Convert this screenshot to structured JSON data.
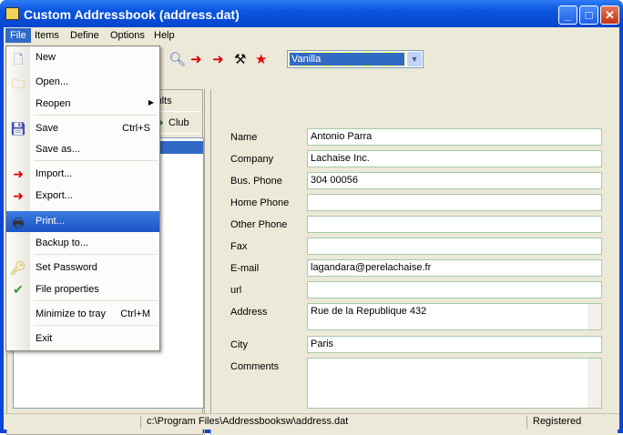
{
  "window": {
    "title": "Custom Addressbook (address.dat)"
  },
  "menubar": [
    "File",
    "Items",
    "Define",
    "Options",
    "Help"
  ],
  "toolbar": {
    "combo_value": "Vanilla"
  },
  "left": {
    "tabs": [
      "sults",
      "Club"
    ]
  },
  "fields": [
    {
      "label": "Name",
      "value": "Antonio Parra"
    },
    {
      "label": "Company",
      "value": "Lachaise Inc."
    },
    {
      "label": "Bus. Phone",
      "value": "304 00056"
    },
    {
      "label": "Home Phone",
      "value": ""
    },
    {
      "label": "Other Phone",
      "value": ""
    },
    {
      "label": "Fax",
      "value": ""
    },
    {
      "label": "E-mail",
      "value": "lagandara@perelachaise.fr"
    },
    {
      "label": "url",
      "value": ""
    },
    {
      "label": "Address",
      "value": "Rue de la Republique 432"
    },
    {
      "label": "City",
      "value": "Paris"
    },
    {
      "label": "Comments",
      "value": ""
    }
  ],
  "file_menu": [
    {
      "label": "New",
      "icon": "new-file-icon",
      "shortcut": ""
    },
    {
      "label": "Open...",
      "icon": "folder-icon",
      "shortcut": ""
    },
    {
      "label": "Reopen",
      "icon": "",
      "shortcut": "",
      "submenu": true
    },
    {
      "label": "Save",
      "icon": "save-icon",
      "shortcut": "Ctrl+S"
    },
    {
      "label": "Save as...",
      "icon": "",
      "shortcut": ""
    },
    {
      "label": "Import...",
      "icon": "import-icon",
      "shortcut": ""
    },
    {
      "label": "Export...",
      "icon": "export-icon",
      "shortcut": ""
    },
    {
      "label": "Print...",
      "icon": "printer-icon",
      "shortcut": ""
    },
    {
      "label": "Backup to...",
      "icon": "",
      "shortcut": ""
    },
    {
      "label": "Set Password",
      "icon": "key-icon",
      "shortcut": ""
    },
    {
      "label": "File properties",
      "icon": "file-properties-icon",
      "shortcut": ""
    },
    {
      "label": "Minimize to tray",
      "icon": "",
      "shortcut": "Ctrl+M"
    },
    {
      "label": "Exit",
      "icon": "",
      "shortcut": ""
    }
  ],
  "status": {
    "path": "c:\\Program Files\\Addressbooksw\\address.dat",
    "registration": "Registered"
  }
}
